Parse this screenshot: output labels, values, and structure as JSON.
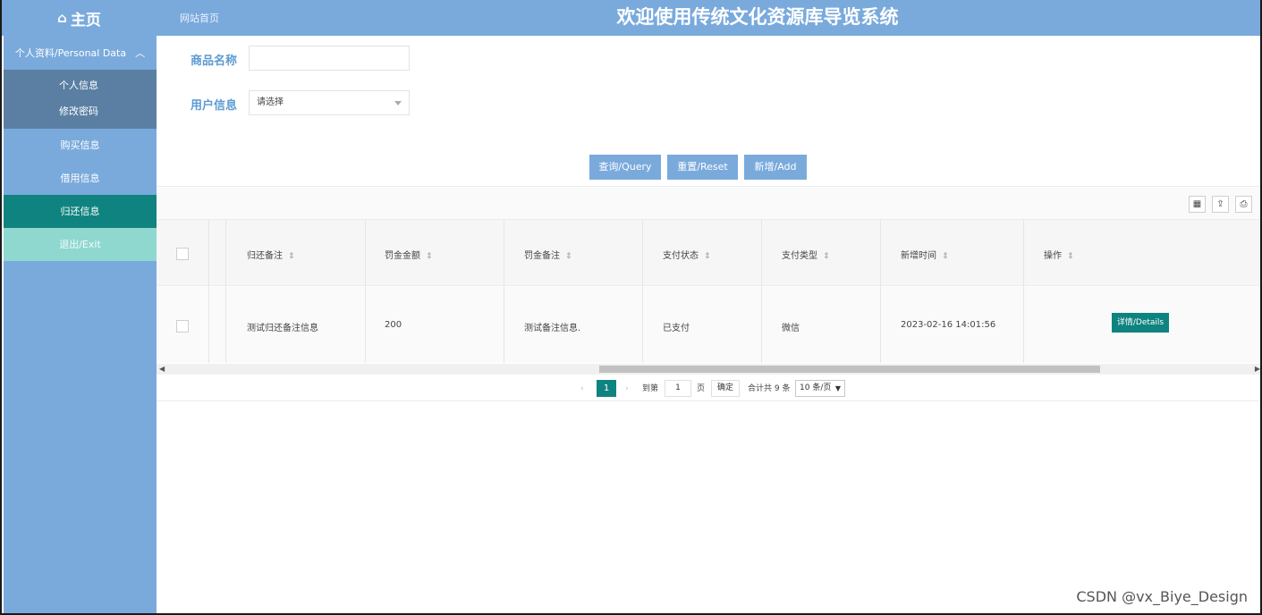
{
  "topbar": {
    "home_label": "主页",
    "site_link": "网站首页",
    "system_title": "欢迎使用传统文化资源库导览系统"
  },
  "sidebar": {
    "group_label": "个人资料/Personal Data",
    "sub_items": [
      "个人信息",
      "修改密码"
    ],
    "items": [
      {
        "label": "购买信息",
        "active": false
      },
      {
        "label": "借用信息",
        "active": false
      },
      {
        "label": "归还信息",
        "active": true
      },
      {
        "label": "退出/Exit",
        "active": false
      }
    ]
  },
  "search": {
    "product_name_label": "商品名称",
    "product_name_value": "",
    "user_info_label": "用户信息",
    "user_info_placeholder": "请选择"
  },
  "actions": {
    "query": "查询/Query",
    "reset": "重置/Reset",
    "add": "新增/Add"
  },
  "table": {
    "columns": [
      "归还备注",
      "罚金金额",
      "罚金备注",
      "支付状态",
      "支付类型",
      "新增时间",
      "操作"
    ],
    "rows": [
      {
        "return_note": "测试归还备注信息",
        "fine_amount": "200",
        "fine_note": "测试备注信息.",
        "pay_status": "已支付",
        "pay_type": "微信",
        "created_at": "2023-02-16 14:01:56",
        "action_label": "详情/Details"
      }
    ]
  },
  "pagination": {
    "current_page": "1",
    "goto_label": "到第",
    "goto_value": "1",
    "page_unit": "页",
    "confirm": "确定",
    "total": "合计共 9 条",
    "page_size": "10 条/页"
  },
  "watermark": "CSDN @vx_Biye_Design",
  "colors": {
    "primary": "#7aaadc",
    "teal": "#0f837f",
    "submenu_bg": "#5a7fa3",
    "exit_bg": "#8fd8cf",
    "label_blue": "#5c9bd1"
  }
}
